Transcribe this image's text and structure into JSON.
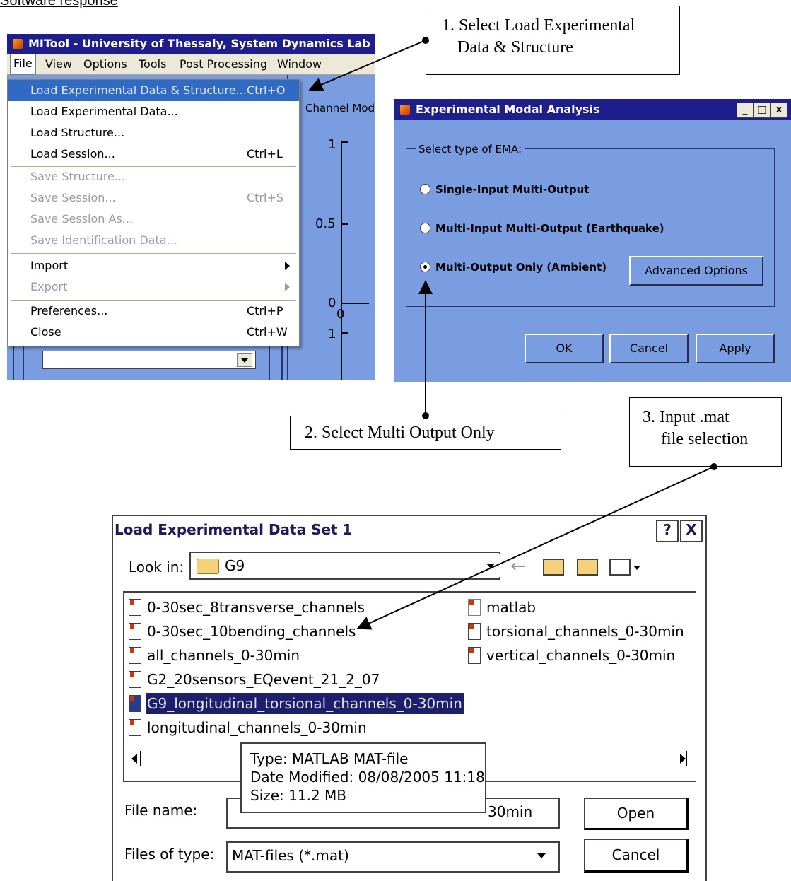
{
  "caption": "Software response",
  "main_window": {
    "title": "MITool - University of Thessaly, System Dynamics Lab",
    "menubar": [
      "File",
      "View",
      "Options",
      "Tools",
      "Post Processing",
      "Window"
    ],
    "channel_label": "Channel Mod",
    "ticks": [
      "1",
      "0.5",
      "0",
      "0",
      "1"
    ]
  },
  "file_menu": {
    "items": [
      {
        "label": "Load Experimental Data & Structure...",
        "shortcut": "Ctrl+O",
        "state": "selected"
      },
      {
        "label": "Load Experimental Data...",
        "shortcut": "",
        "state": "enabled"
      },
      {
        "label": "Load Structure...",
        "shortcut": "",
        "state": "enabled"
      },
      {
        "label": "Load Session...",
        "shortcut": "Ctrl+L",
        "state": "enabled"
      },
      {
        "label": "Save Structure...",
        "shortcut": "",
        "state": "disabled"
      },
      {
        "label": "Save Session...",
        "shortcut": "Ctrl+S",
        "state": "disabled"
      },
      {
        "label": "Save Session As...",
        "shortcut": "",
        "state": "disabled"
      },
      {
        "label": "Save Identification Data...",
        "shortcut": "",
        "state": "disabled"
      },
      {
        "label": "Import",
        "shortcut": "",
        "state": "enabled"
      },
      {
        "label": "Export",
        "shortcut": "",
        "state": "disabled"
      },
      {
        "label": "Preferences...",
        "shortcut": "Ctrl+P",
        "state": "enabled"
      },
      {
        "label": "Close",
        "shortcut": "Ctrl+W",
        "state": "enabled"
      }
    ]
  },
  "callouts": {
    "step1_line1": "1. Select Load Experimental",
    "step1_line2": "Data & Structure",
    "step2": "2. Select Multi Output Only",
    "step3_line1": "3. Input .mat",
    "step3_line2": "file selection"
  },
  "ema_dialog": {
    "title": "Experimental Modal Analysis",
    "group_label": "Select type of EMA:",
    "options": [
      {
        "label": "Single-Input Multi-Output",
        "checked": false
      },
      {
        "label": "Multi-Input Multi-Output (Earthquake)",
        "checked": false
      },
      {
        "label": "Multi-Output Only (Ambient)",
        "checked": true
      }
    ],
    "advanced_button": "Advanced Options",
    "ok_button": "OK",
    "cancel_button": "Cancel",
    "apply_button": "Apply"
  },
  "file_dialog": {
    "title": "Load Experimental Data Set 1",
    "help_button": "?",
    "close_button": "X",
    "look_in_label": "Look in:",
    "look_in_value": "G9",
    "files_left": [
      "0-30sec_8transverse_channels",
      "0-30sec_10bending_channels",
      "all_channels_0-30min",
      "G2_20sensors_EQevent_21_2_07",
      "G9_longitudinal_torsional_channels_0-30min",
      "longitudinal_channels_0-30min"
    ],
    "files_right": [
      "matlab",
      "torsional_channels_0-30min",
      "vertical_channels_0-30min"
    ],
    "selected_file_index": 4,
    "tooltip": {
      "type": "Type: MATLAB MAT-file",
      "date": "Date Modified: 08/08/2005 11:18",
      "size": "Size: 11.2 MB"
    },
    "file_name_label": "File name:",
    "file_name_value": "G9_longitudinal_torsional_channels_0-30min",
    "file_name_visible_tail": "30min",
    "files_of_type_label": "Files of type:",
    "files_of_type_value": "MAT-files (*.mat)",
    "open_button": "Open",
    "cancel_button": "Cancel"
  }
}
